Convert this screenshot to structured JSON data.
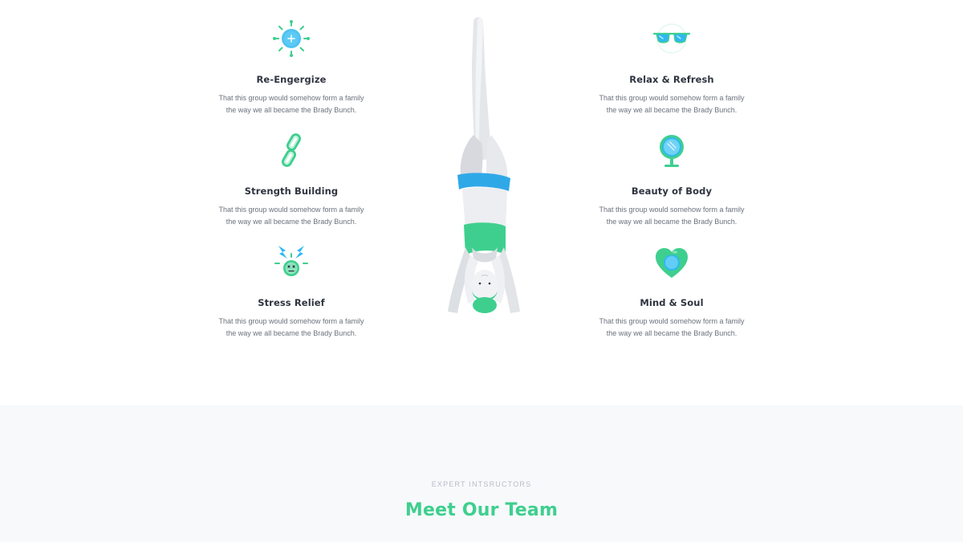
{
  "colors": {
    "accent_green": "#3ecf8e",
    "accent_blue": "#2fb8f0",
    "heading": "#2f3440",
    "body_text": "#6b707c",
    "section_bg": "#f7f9fb"
  },
  "features": {
    "left": [
      {
        "title": "Re-Engergize",
        "desc_line1": "That this group would somehow form a family",
        "desc_line2": "the way we all became the Brady Bunch.",
        "icon": "sun-icon"
      },
      {
        "title": "Strength Building",
        "desc_line1": "That this group would somehow form a family",
        "desc_line2": "the way we all became the Brady Bunch.",
        "icon": "chain-link-icon"
      },
      {
        "title": "Stress Relief",
        "desc_line1": "That this group would somehow form a family",
        "desc_line2": "the way we all became the Brady Bunch.",
        "icon": "lightning-face-icon"
      }
    ],
    "right": [
      {
        "title": "Relax & Refresh",
        "desc_line1": "That this group would somehow form a family",
        "desc_line2": "the way we all became the Brady Bunch.",
        "icon": "sunglasses-icon"
      },
      {
        "title": "Beauty of Body",
        "desc_line1": "That this group would somehow form a family",
        "desc_line2": "the way we all became the Brady Bunch.",
        "icon": "mirror-icon"
      },
      {
        "title": "Mind & Soul",
        "desc_line1": "That this group would somehow form a family",
        "desc_line2": "the way we all became the Brady Bunch.",
        "icon": "heart-apple-icon"
      }
    ]
  },
  "illustration": {
    "icon": "headstand-yoga-figure-icon"
  },
  "team": {
    "eyebrow": "EXPERT INTSRUCTORS",
    "title": "Meet Our Team"
  }
}
